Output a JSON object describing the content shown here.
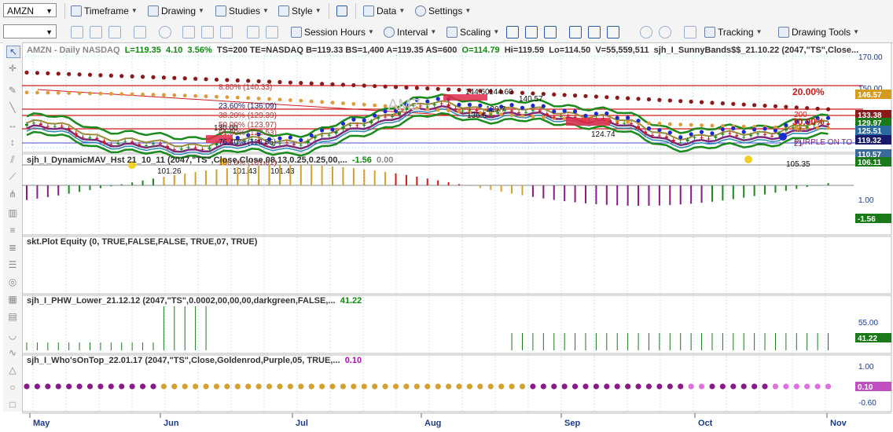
{
  "toolbar1": {
    "symbol": "AMZN",
    "timeframe": "Timeframe",
    "drawing": "Drawing",
    "studies": "Studies",
    "style": "Style",
    "data": "Data",
    "settings": "Settings"
  },
  "toolbar2": {
    "session_hours": "Session Hours",
    "interval": "Interval",
    "scaling": "Scaling",
    "tracking": "Tracking",
    "drawing_tools": "Drawing Tools"
  },
  "header": {
    "symbol_line": "AMZN - Daily  NASDAQ",
    "L": "L=119.35",
    "chg": "4.10",
    "pct": "3.56%",
    "rest": "TS=200  TE=NASDAQ  B=119.33  BS=1,400  A=119.35  AS=600",
    "O": "O=114.79",
    "Hi": "Hi=119.59",
    "Lo": "Lo=114.50",
    "V": "V=55,559,511",
    "study": "sjh_I_SunnyBands$$_21.10.22 (2047,\"TS\",Close..."
  },
  "panels": {
    "p2": {
      "label": "sjh_I_DynamicMAV_Hst 21_10_11 (2047,\"TS\",Close,Close,08,13,0.25,0.25,00,...",
      "v1": "-1.56",
      "v2": "0.00"
    },
    "p3": {
      "label": "skt.Plot Equity (0, TRUE,FALSE,FALSE, TRUE,07, TRUE)"
    },
    "p4": {
      "label": "sjh_I_PHW_Lower_21.12.12 (2047,\"TS\",0.0002,00,00,00,darkgreen,FALSE,...",
      "v1": "41.22"
    },
    "p5": {
      "label": "sjh_I_Who'sOnTop_22.01.17 (2047,\"TS\",Close,Goldenrod,Purple,05, TRUE,...",
      "v1": "0.10"
    }
  },
  "fib": {
    "l1": "8.80% (140.33)",
    "l2": "23.60% (136.09)",
    "l3": "38.20% (129.39)",
    "l4": "50.00% (123.97)",
    "l5": "61.80% (122.53)",
    "l6": "76.40% (118.85)",
    "l7": "100.0% (101.01)",
    "amz": "AMZ",
    "p20": "20.00%",
    "p30": "30.00%",
    "n200": "200",
    "n50": "50",
    "n21": "21",
    "purple": "PURPLE ON TO"
  },
  "annotations": {
    "a1": "144.60",
    "a2": "144.60",
    "a3": "139.7",
    "a4": "136.6",
    "a5": "140.57",
    "a6": "124.74",
    "a7": "101.26",
    "a8": "101.43",
    "a9": "101.43",
    "a10": "105.35",
    "a11": "130.00"
  },
  "axis": {
    "ticks_main": [
      "170.00",
      "150.00"
    ],
    "p2_ticks": [
      "1.00"
    ],
    "p4_ticks": [
      "55.00"
    ],
    "p5_ticks": [
      "1.00",
      "-0.60"
    ],
    "tags": [
      {
        "text": "146.57",
        "color": "#d49b1e"
      },
      {
        "text": "133.38",
        "color": "#8a1a1a"
      },
      {
        "text": "129.97",
        "color": "#1a7a1a"
      },
      {
        "text": "125.51",
        "color": "#2a6aa0"
      },
      {
        "text": "119.32",
        "color": "#1a1a6a"
      },
      {
        "text": "110.57",
        "color": "#3a6a9a"
      },
      {
        "text": "106.11",
        "color": "#1a7a1a"
      }
    ],
    "tag_p2": {
      "text": "-1.56",
      "color": "#1a7a1a"
    },
    "tag_p4": {
      "text": "41.22",
      "color": "#1a7a1a"
    },
    "tag_p5": {
      "text": "0.10",
      "color": "#c050c0"
    }
  },
  "xaxis": [
    "May",
    "Jun",
    "Jul",
    "Aug",
    "Sep",
    "Oct",
    "Nov"
  ],
  "colors": {
    "up": "#1a8a1a",
    "down": "#c81e1e",
    "ma_green": "#1a8a1a",
    "ma_purple": "#7a2a7a",
    "ma_blue": "#1a2ad0",
    "dots_maroon": "#8a1a1a",
    "dots_orange": "#e09a3a",
    "fib_red": "#d01a1a",
    "hist_purple": "#8a1a8a",
    "hist_green": "#1a8a1a",
    "hist_gold": "#d4a030",
    "hist_red": "#d01a1a"
  },
  "chart_data": {
    "type": "line",
    "title": "AMZN - Daily  NASDAQ",
    "x": [
      "May",
      "Jun",
      "Jul",
      "Aug",
      "Sep",
      "Oct",
      "Nov"
    ],
    "series": [
      {
        "values": [
          120,
          104,
          108,
          134,
          128,
          110,
          119.35
        ]
      }
    ],
    "ylim": [
      100,
      172
    ]
  }
}
